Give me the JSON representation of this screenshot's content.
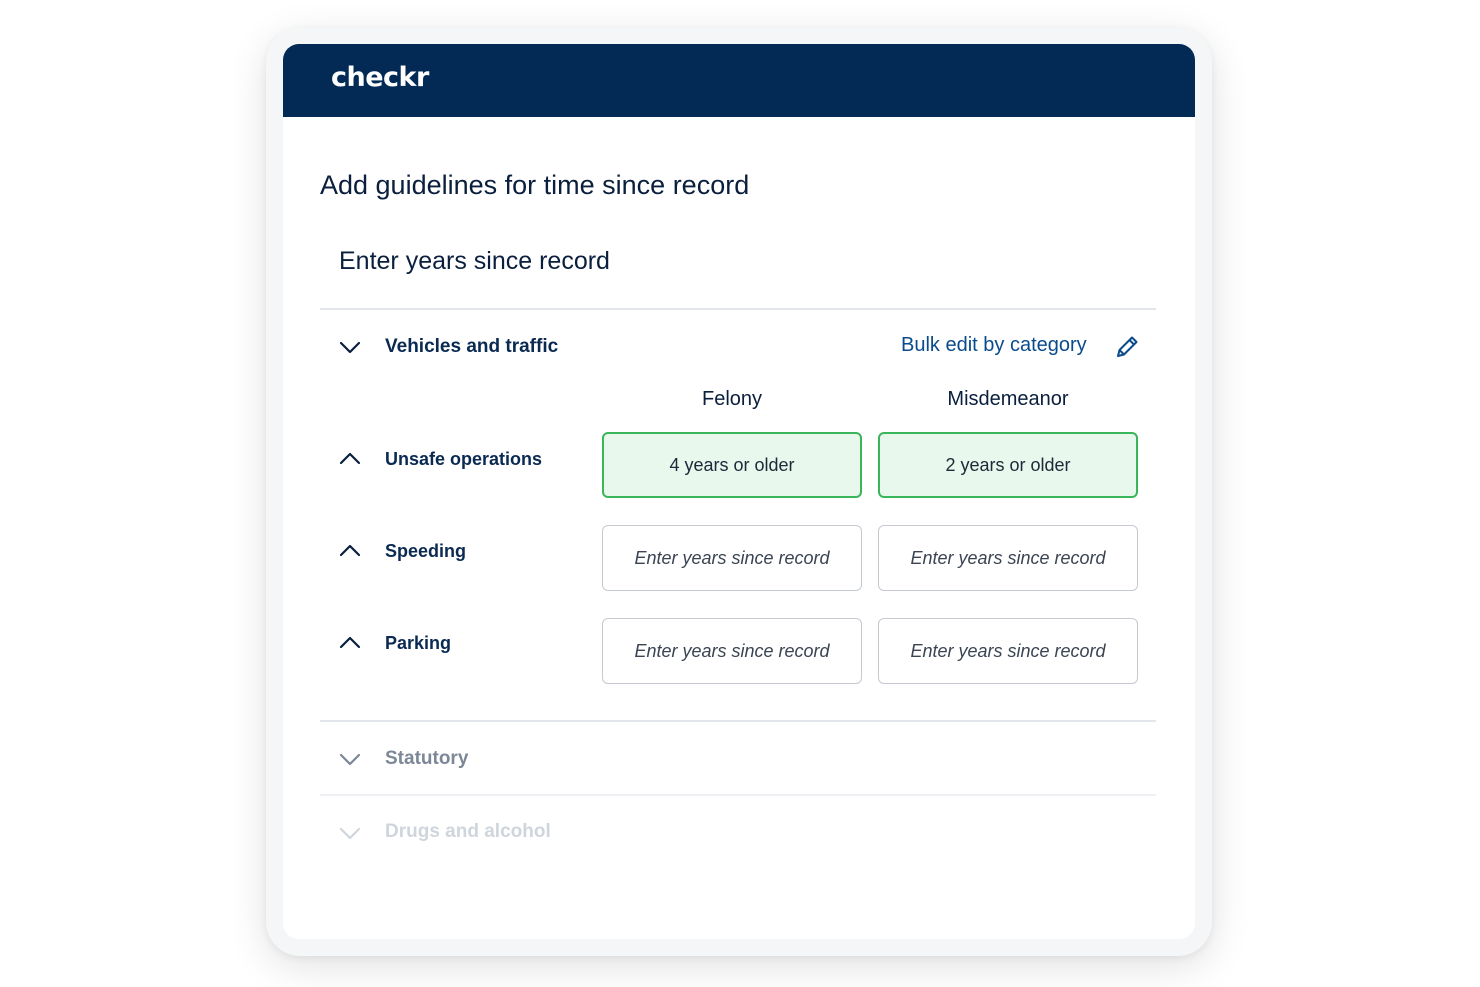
{
  "app": {
    "logo_text": "checkr",
    "brand_color": "#032a55",
    "accent_green": "#3bb55a"
  },
  "page": {
    "title": "Add guidelines for time since record",
    "section_title": "Enter years since record"
  },
  "categories": [
    {
      "label": "Vehicles and traffic",
      "expanded": true,
      "icon": "chevron-down-icon",
      "bulk_edit_label": "Bulk edit by category",
      "bulk_edit_icon": "pencil-icon",
      "columns": [
        "Felony",
        "Misdemeanor"
      ],
      "rows": [
        {
          "label": "Unsafe operations",
          "icon": "chevron-up-icon",
          "felony": "4 years or older",
          "misdemeanor": "2 years or older"
        },
        {
          "label": "Speeding",
          "icon": "chevron-up-icon",
          "felony_placeholder": "Enter years since record",
          "misdemeanor_placeholder": "Enter years since record"
        },
        {
          "label": "Parking",
          "icon": "chevron-up-icon",
          "felony_placeholder": "Enter years since record",
          "misdemeanor_placeholder": "Enter years since record"
        }
      ]
    },
    {
      "label": "Statutory",
      "expanded": false,
      "icon": "chevron-down-icon"
    },
    {
      "label": "Drugs and alcohol",
      "expanded": false,
      "icon": "chevron-down-icon"
    }
  ]
}
